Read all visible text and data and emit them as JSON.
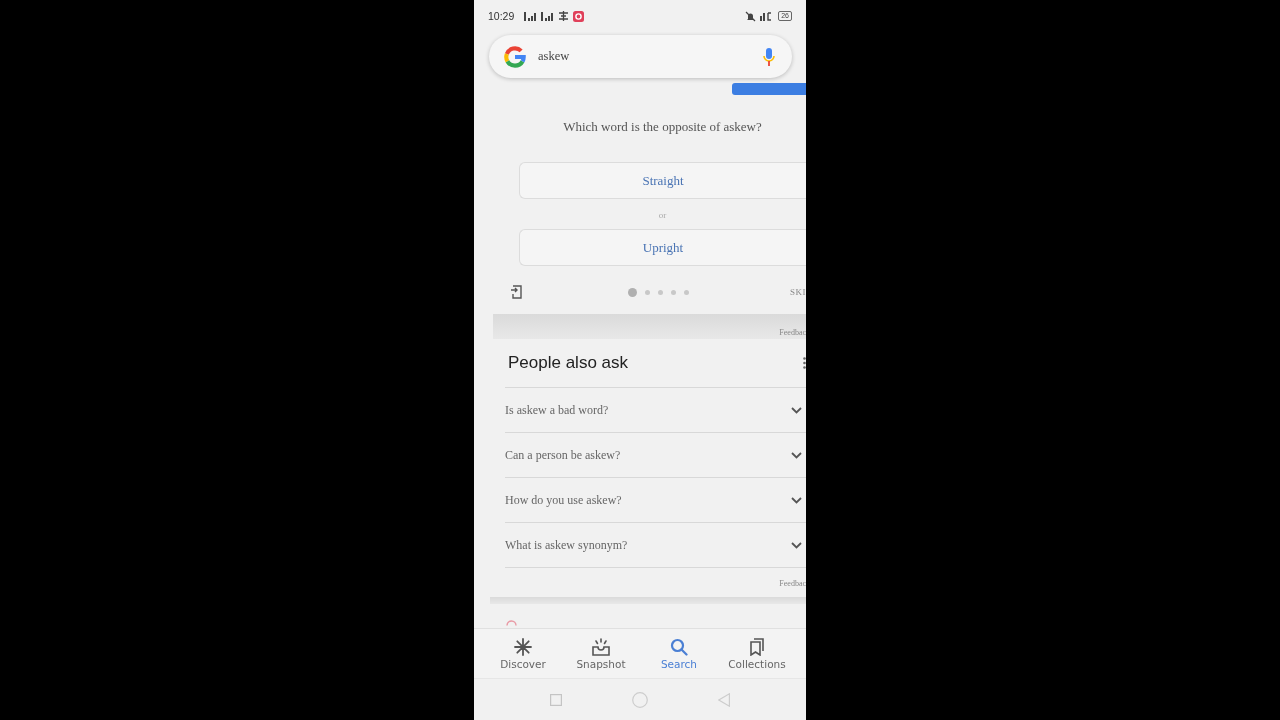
{
  "status_bar": {
    "time": "10:29",
    "battery": "26"
  },
  "search": {
    "value": "askew"
  },
  "quiz": {
    "question": "Which word is the opposite of askew?",
    "options": [
      {
        "label": "Straight"
      },
      {
        "label": "Upright"
      }
    ],
    "separator": "or",
    "pages": [
      {
        "selected": true
      },
      {
        "selected": false
      },
      {
        "selected": false
      },
      {
        "selected": false
      },
      {
        "selected": false
      }
    ],
    "skip": "SKI",
    "feedback": "Feedbac"
  },
  "people_also_ask": {
    "title": "People also ask",
    "questions": [
      {
        "text": "Is askew a bad word?",
        "expanded": false
      },
      {
        "text": "Can a person be askew?",
        "expanded": false
      },
      {
        "text": "How do you use askew?",
        "expanded": false
      },
      {
        "text": "What is askew synonym?",
        "expanded": false
      }
    ],
    "feedback": "Feedbac"
  },
  "bottom_nav": [
    {
      "kind": "discover",
      "label": "Discover",
      "selected": false
    },
    {
      "kind": "snapshot",
      "label": "Snapshot",
      "selected": false
    },
    {
      "kind": "search",
      "label": "Search",
      "selected": true
    },
    {
      "kind": "collections",
      "label": "Collections",
      "selected": false
    }
  ]
}
